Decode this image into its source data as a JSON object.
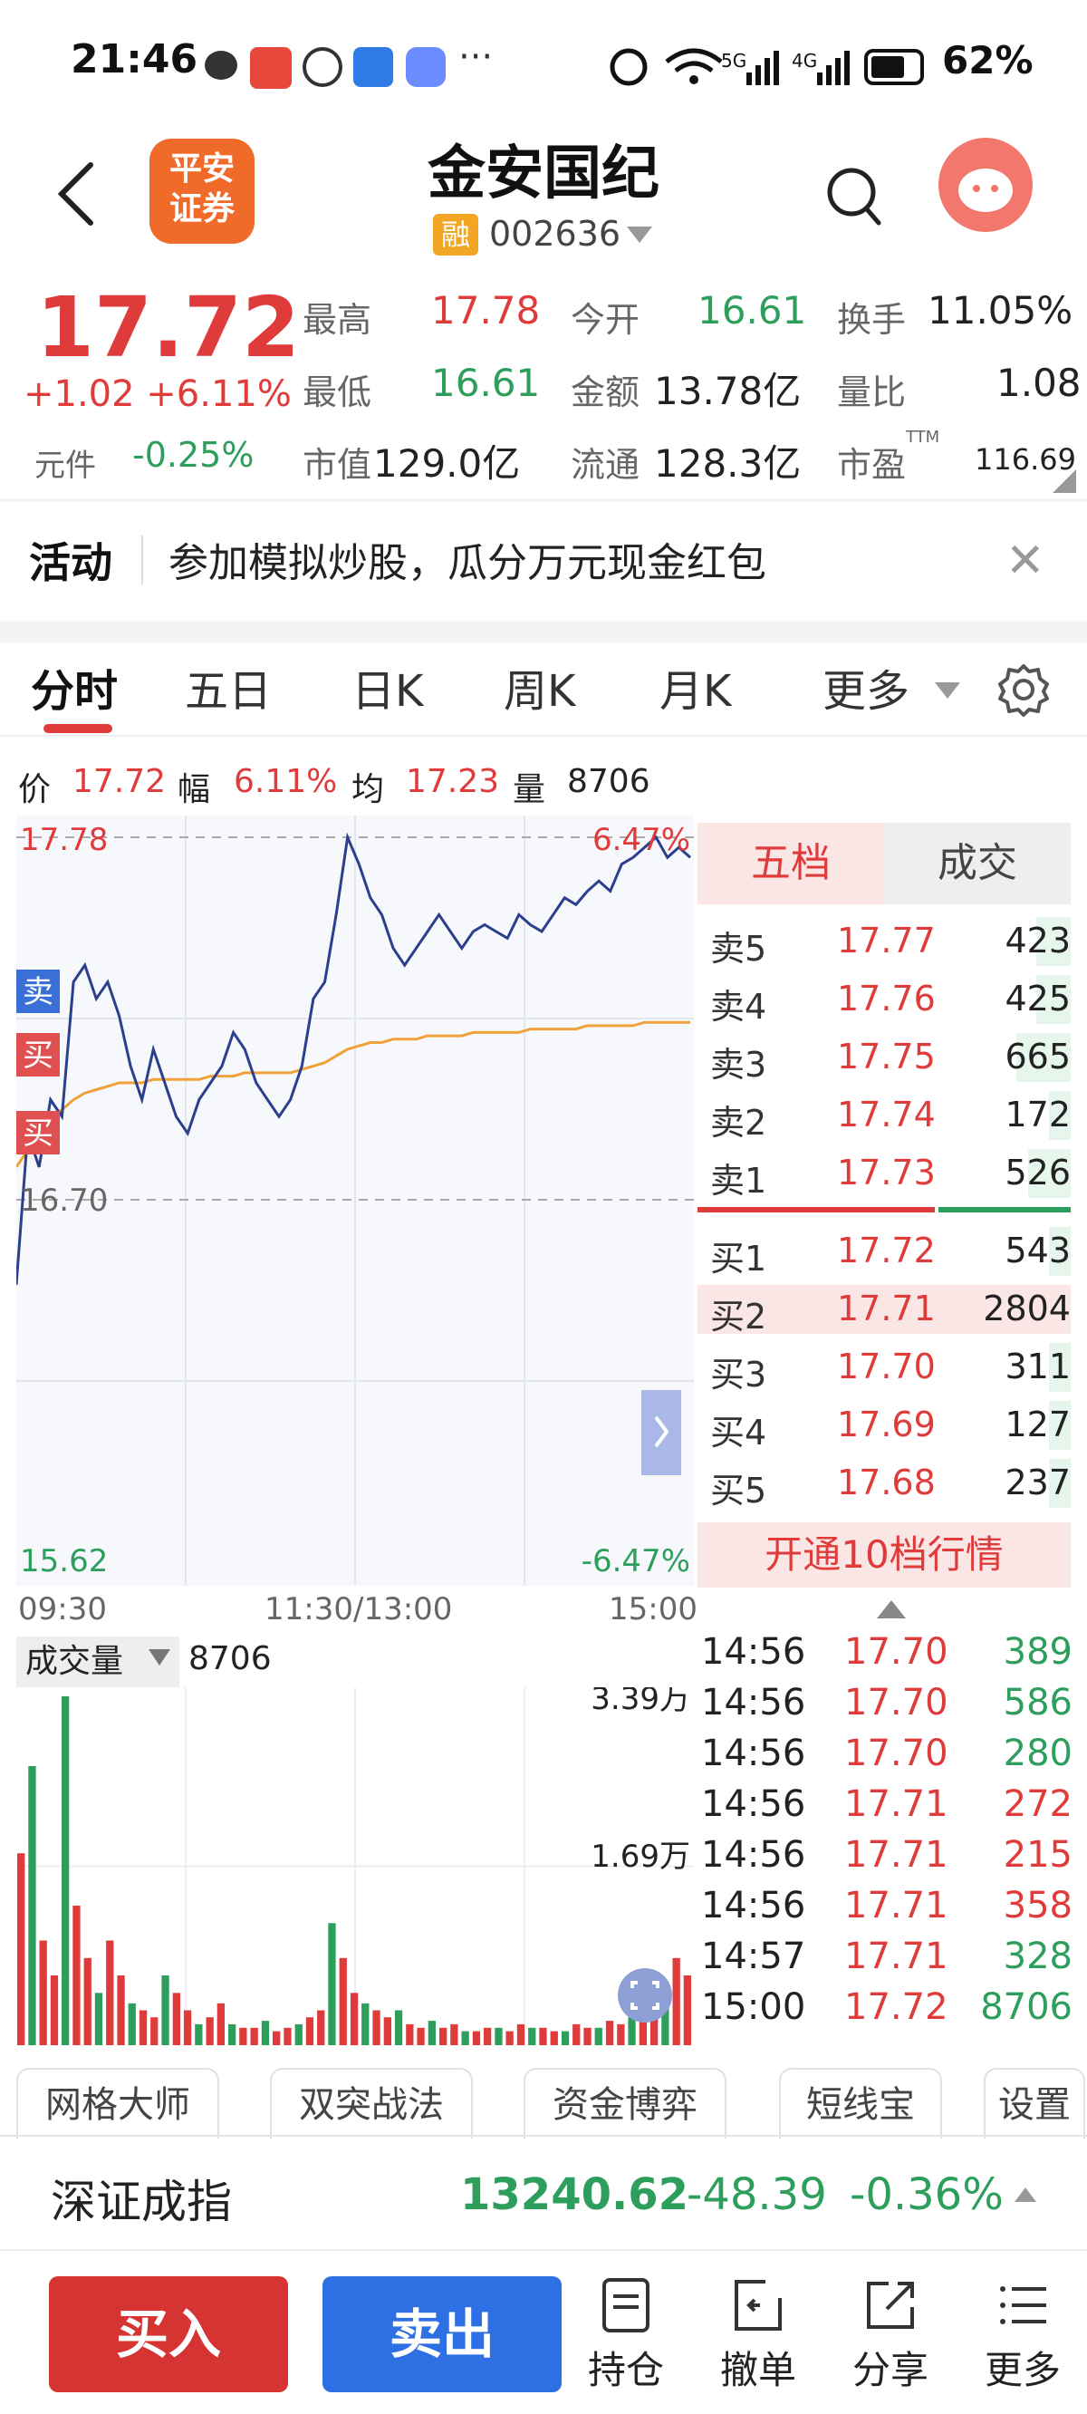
{
  "status": {
    "time": "21:46",
    "battery": "62%"
  },
  "header": {
    "title": "金安国纪",
    "tag": "融",
    "code": "002636",
    "logo_text": "平安\n证券"
  },
  "quote": {
    "price": "17.72",
    "change": "+1.02  +6.11%",
    "yuanjian_label": "元件",
    "yuanjian_value": "-0.25%",
    "high_label": "最高",
    "high": "17.78",
    "low_label": "最低",
    "low": "16.61",
    "mcap_label": "市值",
    "mcap": "129.0亿",
    "open_label": "今开",
    "open": "16.61",
    "amount_label": "金额",
    "amount": "13.78亿",
    "float_label": "流通",
    "float": "128.3亿",
    "turnover_label": "换手",
    "turnover": "11.05%",
    "vr_label": "量比",
    "vr": "1.08",
    "pe_label": "市盈",
    "pe_sup": "TTM",
    "pe": "116.69"
  },
  "activity": {
    "label": "活动",
    "text": "参加模拟炒股，瓜分万元现金红包"
  },
  "tabs": [
    "分时",
    "五日",
    "日K",
    "周K",
    "月K",
    "更多"
  ],
  "legend": {
    "price_label": "价",
    "price": "17.72",
    "amp_label": "幅",
    "amp": "6.11%",
    "avg_label": "均",
    "avg": "17.23",
    "vol_label": "量",
    "vol": "8706"
  },
  "chart_data": {
    "type": "line",
    "series": [
      {
        "values": [
          16.45,
          16.9,
          16.8,
          17.0,
          16.95,
          17.35,
          17.4,
          17.3,
          17.35,
          17.25,
          17.1,
          17.0,
          17.15,
          17.05,
          16.95,
          16.9,
          17.0,
          17.05,
          17.1,
          17.2,
          17.15,
          17.05,
          17.0,
          16.95,
          17.0,
          17.1,
          17.3,
          17.35,
          17.55,
          17.78,
          17.7,
          17.6,
          17.55,
          17.45,
          17.4,
          17.45,
          17.5,
          17.55,
          17.5,
          17.45,
          17.5,
          17.52,
          17.5,
          17.48,
          17.55,
          17.52,
          17.5,
          17.55,
          17.6,
          17.58,
          17.62,
          17.65,
          17.62,
          17.7,
          17.72,
          17.75,
          17.78,
          17.72,
          17.75,
          17.72
        ]
      },
      {
        "values": [
          16.8,
          16.85,
          16.9,
          16.95,
          16.97,
          17.0,
          17.02,
          17.03,
          17.04,
          17.05,
          17.05,
          17.05,
          17.06,
          17.06,
          17.06,
          17.06,
          17.06,
          17.07,
          17.07,
          17.07,
          17.08,
          17.08,
          17.08,
          17.08,
          17.08,
          17.09,
          17.1,
          17.11,
          17.13,
          17.15,
          17.16,
          17.17,
          17.17,
          17.18,
          17.18,
          17.18,
          17.19,
          17.19,
          17.19,
          17.19,
          17.2,
          17.2,
          17.2,
          17.2,
          17.2,
          17.21,
          17.21,
          17.21,
          17.21,
          17.21,
          17.22,
          17.22,
          17.22,
          17.22,
          17.22,
          17.23,
          17.23,
          17.23,
          17.23,
          17.23
        ]
      }
    ],
    "yticks_left": [
      "17.78",
      "16.70",
      "15.62"
    ],
    "yticks_right": [
      "6.47%",
      "-6.47%"
    ],
    "xticks": [
      "09:30",
      "11:30/13:00",
      "15:00"
    ],
    "ylim": [
      15.62,
      17.78
    ],
    "markers": [
      "卖",
      "买",
      "买"
    ]
  },
  "volume": {
    "label": "成交量",
    "value": "8706",
    "ticks": [
      "3.39万",
      "1.69万"
    ],
    "bars": [
      0.55,
      0.8,
      0.3,
      0.2,
      1.0,
      0.4,
      0.25,
      0.15,
      0.3,
      0.2,
      0.12,
      0.1,
      0.08,
      0.2,
      0.15,
      0.1,
      0.06,
      0.08,
      0.12,
      0.06,
      0.05,
      0.05,
      0.07,
      0.04,
      0.05,
      0.06,
      0.08,
      0.1,
      0.35,
      0.25,
      0.15,
      0.12,
      0.1,
      0.08,
      0.1,
      0.06,
      0.05,
      0.07,
      0.05,
      0.06,
      0.04,
      0.04,
      0.05,
      0.05,
      0.04,
      0.06,
      0.05,
      0.05,
      0.04,
      0.04,
      0.06,
      0.05,
      0.05,
      0.07,
      0.06,
      0.08,
      0.1,
      0.12,
      0.18,
      0.25,
      0.2
    ]
  },
  "book": {
    "tab_active": "五档",
    "tab_other": "成交",
    "sells": [
      {
        "label": "卖5",
        "price": "17.77",
        "vol": "423"
      },
      {
        "label": "卖4",
        "price": "17.76",
        "vol": "425"
      },
      {
        "label": "卖3",
        "price": "17.75",
        "vol": "665"
      },
      {
        "label": "卖2",
        "price": "17.74",
        "vol": "172"
      },
      {
        "label": "卖1",
        "price": "17.73",
        "vol": "526"
      }
    ],
    "buys": [
      {
        "label": "买1",
        "price": "17.72",
        "vol": "543"
      },
      {
        "label": "买2",
        "price": "17.71",
        "vol": "2804"
      },
      {
        "label": "买3",
        "price": "17.70",
        "vol": "311"
      },
      {
        "label": "买4",
        "price": "17.69",
        "vol": "127"
      },
      {
        "label": "买5",
        "price": "17.68",
        "vol": "237"
      }
    ],
    "open10": "开通10档行情"
  },
  "trades": [
    {
      "t": "14:56",
      "p": "17.70",
      "v": "389",
      "dir": "sell"
    },
    {
      "t": "14:56",
      "p": "17.70",
      "v": "586",
      "dir": "sell"
    },
    {
      "t": "14:56",
      "p": "17.70",
      "v": "280",
      "dir": "sell"
    },
    {
      "t": "14:56",
      "p": "17.71",
      "v": "272",
      "dir": "buy"
    },
    {
      "t": "14:56",
      "p": "17.71",
      "v": "215",
      "dir": "buy"
    },
    {
      "t": "14:56",
      "p": "17.71",
      "v": "358",
      "dir": "buy"
    },
    {
      "t": "14:57",
      "p": "17.71",
      "v": "328",
      "dir": "sell"
    },
    {
      "t": "15:00",
      "p": "17.72",
      "v": "8706",
      "dir": "sell"
    }
  ],
  "tools": [
    "网格大师",
    "双突战法",
    "资金博弈",
    "短线宝",
    "设置"
  ],
  "index": {
    "name": "深证成指",
    "value": "13240.62",
    "change": "-48.39",
    "pct": "-0.36%"
  },
  "bottom": {
    "buy": "买入",
    "sell": "卖出",
    "hold": "持仓",
    "cancel": "撤单",
    "share": "分享",
    "more": "更多"
  },
  "colors": {
    "up": "#e03b3b",
    "down": "#2e9e5c",
    "price_line": "#2b3f8c",
    "avg_line": "#f0a23a"
  }
}
